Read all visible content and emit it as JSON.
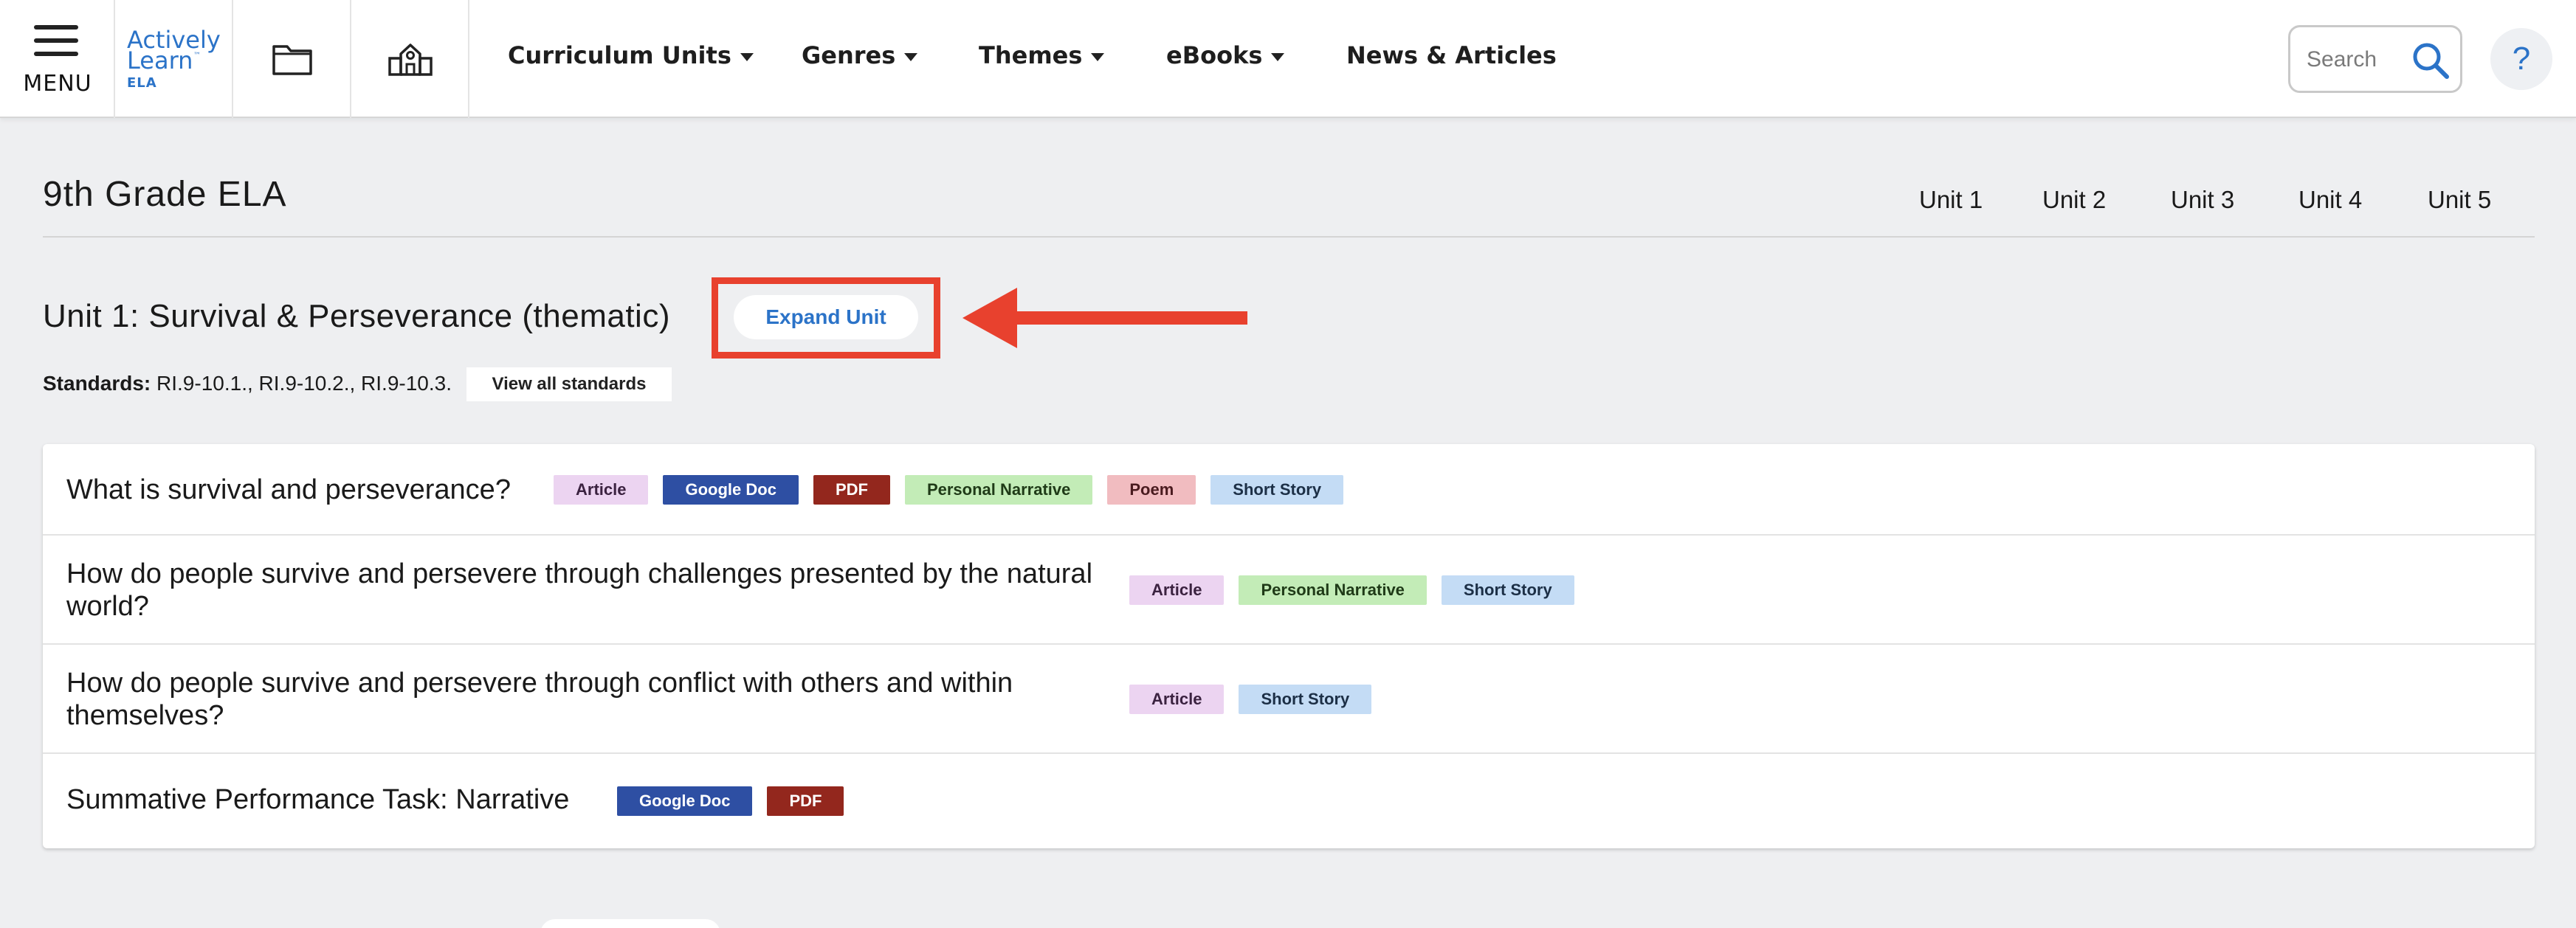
{
  "nav": {
    "menu_label": "MENU",
    "logo": {
      "line1": "Actively",
      "line2": "Learn",
      "sub": "ELA",
      "tm": "™"
    },
    "links": [
      {
        "label": "Curriculum Units",
        "has_dropdown": true
      },
      {
        "label": "Genres",
        "has_dropdown": true
      },
      {
        "label": "Themes",
        "has_dropdown": true
      },
      {
        "label": "eBooks",
        "has_dropdown": true
      },
      {
        "label": "News & Articles",
        "has_dropdown": false
      }
    ],
    "search_placeholder": "Search",
    "help_label": "?"
  },
  "page": {
    "title": "9th Grade ELA",
    "unit_tabs": [
      "Unit 1",
      "Unit 2",
      "Unit 3",
      "Unit 4",
      "Unit 5"
    ]
  },
  "unit": {
    "heading": "Unit 1: Survival & Perseverance (thematic)",
    "expand_label": "Expand Unit",
    "standards_label": "Standards:",
    "standards_value": "RI.9-10.1., RI.9-10.2., RI.9-10.3.",
    "view_standards_label": "View all standards"
  },
  "lessons": [
    {
      "title": "What is survival and perseverance?",
      "tags": [
        "Article",
        "Google Doc",
        "PDF",
        "Personal Narrative",
        "Poem",
        "Short Story"
      ]
    },
    {
      "title": "How do people survive and persevere through challenges presented by the natural world?",
      "tags": [
        "Article",
        "Personal Narrative",
        "Short Story"
      ]
    },
    {
      "title": "How do people survive and persevere through conflict with others and within themselves?",
      "tags": [
        "Article",
        "Short Story"
      ]
    },
    {
      "title": "Summative Performance Task: Narrative",
      "tags": [
        "Google Doc",
        "PDF"
      ]
    }
  ],
  "colors": {
    "brand_blue": "#2b73c8",
    "highlight_red": "#e8412e",
    "tag_article": "#ecd4f1",
    "tag_google_doc": "#2e4fa3",
    "tag_pdf": "#93271d",
    "tag_personal_narrative": "#c3ecb7",
    "tag_poem": "#f1bcc0",
    "tag_short_story": "#c4dcf5"
  },
  "icons": {
    "menu": "hamburger-icon",
    "folder": "folder-icon",
    "school": "school-icon",
    "search": "search-icon",
    "help": "help-icon",
    "annotation": "arrow-left-icon"
  }
}
